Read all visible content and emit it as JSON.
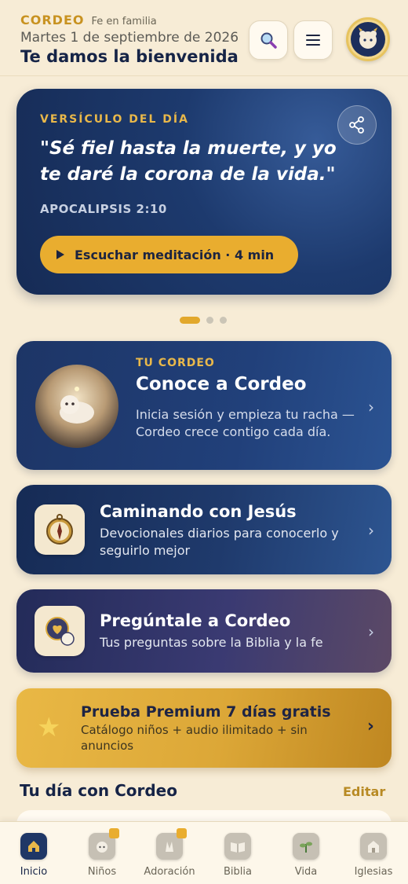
{
  "header": {
    "brand": "CORDEO",
    "tagline": "Fe en familia",
    "date": "Martes 1 de septiembre de 2026",
    "welcome": "Te damos la bienvenida"
  },
  "verse_card": {
    "label": "VERSÍCULO DEL DÍA",
    "text": "\"Sé fiel hasta la muerte, y yo te daré la corona de la vida.\"",
    "reference": "APOCALIPSIS 2:10",
    "listen_label": "Escuchar meditación · 4 min"
  },
  "carousel": {
    "pages": 3,
    "active": 1
  },
  "cordeo_card": {
    "kicker": "TU CORDEO",
    "title": "Conoce a Cordeo",
    "description": "Inicia sesión y empieza tu racha — Cordeo crece contigo cada día."
  },
  "walk_card": {
    "title": "Caminando con Jesús",
    "description": "Devocionales diarios para conocerlo y seguirlo mejor"
  },
  "ask_card": {
    "title": "Pregúntale a Cordeo",
    "description": "Tus preguntas sobre la Biblia y la fe"
  },
  "premium_card": {
    "title": "Prueba Premium 7 días gratis",
    "description": "Catálogo niños + audio ilimitado + sin anuncios"
  },
  "day_section": {
    "title": "Tu día con Cordeo",
    "edit_label": "Editar"
  },
  "nav": {
    "items": [
      {
        "label": "Inicio",
        "icon": "home-icon",
        "active": true,
        "locked": false
      },
      {
        "label": "Niños",
        "icon": "kids-icon",
        "active": false,
        "locked": true
      },
      {
        "label": "Adoración",
        "icon": "worship-icon",
        "active": false,
        "locked": true
      },
      {
        "label": "Biblia",
        "icon": "bible-icon",
        "active": false,
        "locked": false
      },
      {
        "label": "Vida",
        "icon": "life-icon",
        "active": false,
        "locked": false
      },
      {
        "label": "Iglesias",
        "icon": "church-icon",
        "active": false,
        "locked": false
      }
    ]
  },
  "colors": {
    "background": "#f7ecd6",
    "navy": "#1d3a6e",
    "gold": "#e9ad2f"
  }
}
